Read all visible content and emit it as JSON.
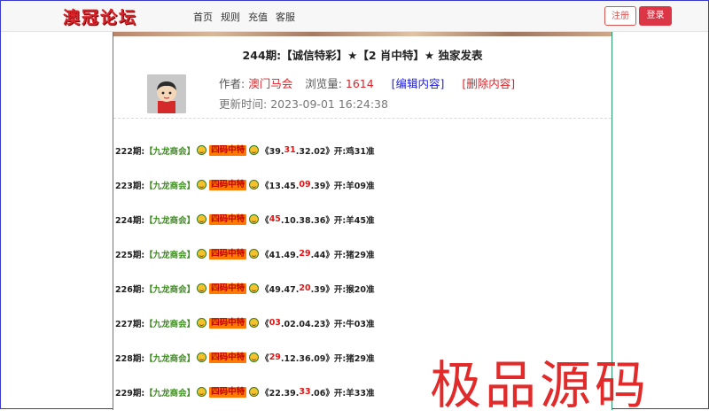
{
  "header": {
    "logo": "澳冠论坛",
    "nav": [
      "首页",
      "规则",
      "充值",
      "客服"
    ],
    "register_label": "注册",
    "login_label": "登录"
  },
  "post": {
    "title": "244期:【诚信特彩】★【2 肖中特】★ 独家发表",
    "author_label": "作者:",
    "author": "澳门马会",
    "views_label": "浏览量:",
    "views": "1614",
    "edit_label": "[编辑内容]",
    "delete_label": "[删除内容]",
    "updated_label": "更新时间:",
    "updated": "2023-09-01 16:24:38"
  },
  "records": [
    {
      "period": "222期:",
      "source": "【九龙商会】",
      "tag": "四码中特",
      "pre": "《39.",
      "hit": "31",
      "post": ".32.02》",
      "result": "开:鸡31准"
    },
    {
      "period": "223期:",
      "source": "【九龙商会】",
      "tag": "四码中特",
      "pre": "《13.45.",
      "hit": "09",
      "post": ".39》",
      "result": "开:羊09准"
    },
    {
      "period": "224期:",
      "source": "【九龙商会】",
      "tag": "四码中特",
      "pre": "《",
      "hit": "45",
      "post": ".10.38.36》",
      "result": "开:羊45准"
    },
    {
      "period": "225期:",
      "source": "【九龙商会】",
      "tag": "四码中特",
      "pre": "《41.49.",
      "hit": "29",
      "post": ".44》",
      "result": "开:猪29准"
    },
    {
      "period": "226期:",
      "source": "【九龙商会】",
      "tag": "四码中特",
      "pre": "《49.47.",
      "hit": "20",
      "post": ".39》",
      "result": "开:猴20准"
    },
    {
      "period": "227期:",
      "source": "【九龙商会】",
      "tag": "四码中特",
      "pre": "《",
      "hit": "03",
      "post": ".02.04.23》",
      "result": "开:牛03准"
    },
    {
      "period": "228期:",
      "source": "【九龙商会】",
      "tag": "四码中特",
      "pre": "《",
      "hit": "29",
      "post": ".12.36.09》",
      "result": "开:猪29准"
    },
    {
      "period": "229期:",
      "source": "【九龙商会】",
      "tag": "四码中特",
      "pre": "《22.39.",
      "hit": "33",
      "post": ".06》",
      "result": "开:羊33准"
    }
  ],
  "watermark": "极品源码",
  "colors": {
    "accent_red": "#d8232a",
    "panel_border": "#2c9d6a",
    "tag_bg": "#ff7a00"
  }
}
